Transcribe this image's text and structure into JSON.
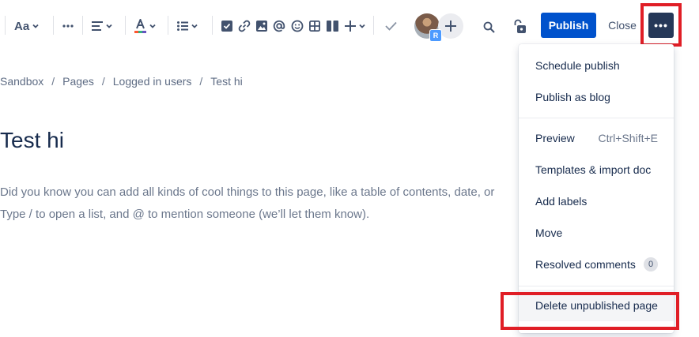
{
  "toolbar": {
    "text_style_label": "Aa",
    "publish_label": "Publish",
    "close_label": "Close",
    "more_label": "•••",
    "avatar_badge": "R"
  },
  "breadcrumb": [
    "Sandbox",
    "Pages",
    "Logged in users",
    "Test hi"
  ],
  "page": {
    "title": "Test hi",
    "body_line1": "Did you know you can add all kinds of cool things to this page, like a table of contents, date, or",
    "body_line2": "Type / to open a list, and @ to mention someone (we’ll let them know)."
  },
  "menu": {
    "schedule_publish": "Schedule publish",
    "publish_as_blog": "Publish as blog",
    "preview": "Preview",
    "preview_shortcut": "Ctrl+Shift+E",
    "templates_import": "Templates & import doc",
    "add_labels": "Add labels",
    "move": "Move",
    "resolved_comments": "Resolved comments",
    "resolved_count": "0",
    "delete_unpublished": "Delete unpublished page"
  },
  "colors": {
    "publish_bg": "#0052cc",
    "more_bg": "#253858",
    "highlight": "#e01e26"
  }
}
